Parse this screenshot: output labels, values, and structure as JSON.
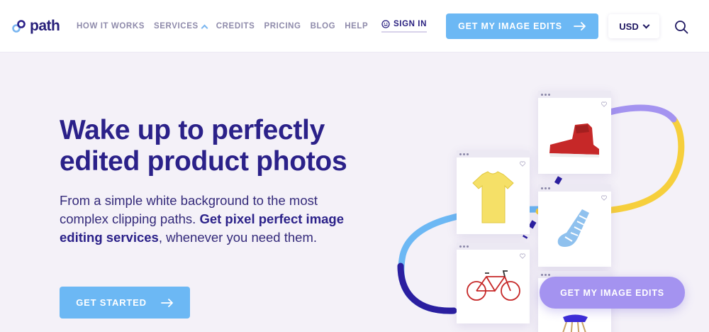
{
  "brand": {
    "name": "path"
  },
  "nav": {
    "links": [
      "HOW IT WORKS",
      "SERVICES",
      "CREDITS",
      "PRICING",
      "BLOG",
      "HELP"
    ],
    "signin": "SIGN IN",
    "cta": "GET MY IMAGE EDITS",
    "currency": "USD"
  },
  "hero": {
    "headline": "Wake up to perfectly edited product photos",
    "sub_part1": "From a simple white background to the most complex clipping paths. ",
    "sub_bold": "Get pixel perfect image editing services",
    "sub_part2": ", whenever you need them.",
    "cta": "GET STARTED"
  },
  "illustration": {
    "cta": "GET MY IMAGE EDITS",
    "items": [
      "red-sneaker-icon",
      "yellow-tshirt-icon",
      "striped-sock-icon",
      "red-bicycle-icon",
      "blue-chair-icon"
    ]
  },
  "colors": {
    "brand": "#2b2189",
    "accent_blue": "#6cb8f4",
    "accent_purple": "#a493f0",
    "accent_yellow": "#f6cf3c",
    "background": "#f4f1f8"
  }
}
